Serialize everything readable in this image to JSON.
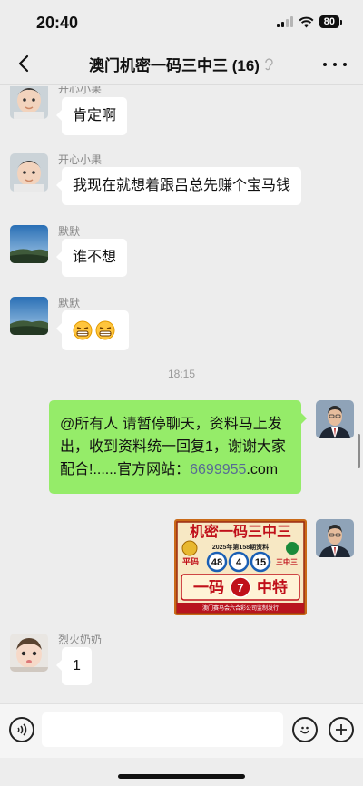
{
  "status": {
    "time": "20:40",
    "battery": "80"
  },
  "header": {
    "title": "澳门机密一码三中三 (16)"
  },
  "messages": [
    {
      "sender": "开心小果",
      "text": "肯定啊"
    },
    {
      "sender": "开心小果",
      "text": "我现在就想着跟吕总先赚个宝马钱"
    },
    {
      "sender": "默默",
      "text": "谁不想"
    },
    {
      "sender": "默默",
      "emoji": "grin-emoji"
    },
    {
      "timestamp": "18:15"
    },
    {
      "self": true,
      "text_part1": "@所有人 请暂停聊天，资料马上发出，收到资料统一回复1，谢谢大家配合!......官方网站：",
      "link": "6699955",
      "text_part2": ".com"
    },
    {
      "self": true,
      "image": {
        "title": "机密一码三中三",
        "subtitle": "2025年第158期资料",
        "left_label": "平码",
        "numbers": [
          "48",
          "4",
          "15"
        ],
        "right_label": "三中三",
        "bottom_left": "一码",
        "bottom_number": "7",
        "bottom_right": "中特",
        "footer": "澳门赛马会六合彩公司监制发行"
      }
    },
    {
      "sender": "烈火奶奶",
      "text": "1"
    }
  ],
  "input": {
    "placeholder": ""
  },
  "colors": {
    "self_bubble": "#95ec69",
    "link": "#576b95",
    "background": "#ededed"
  }
}
